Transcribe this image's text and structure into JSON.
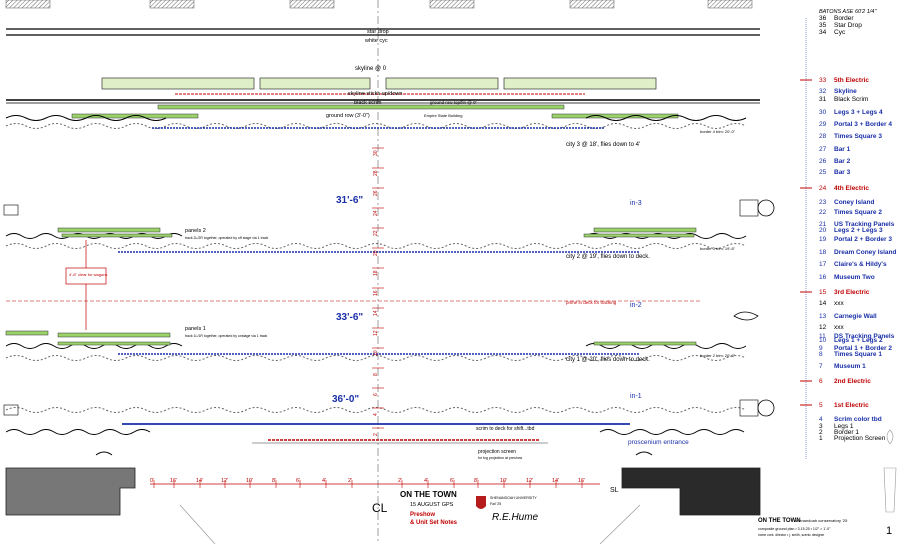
{
  "drawing": {
    "center_mark": "CL",
    "sl_mark": "SL",
    "title_block": {
      "show": "ON THE TOWN",
      "date": "15 AUGUST GPS",
      "note1": "Preshow",
      "note2": "& Unit Set Notes",
      "school": "SHENANDOAH UNIVERSITY",
      "term": "Fall '25",
      "signature": "R.E.Hume"
    },
    "corner_title": {
      "show": "ON THE TOWN",
      "sub1": "shenandoah conservatory '25",
      "sub2": "composite ground plan  •  3.15.25  •  1/2\" = 1'-0\"",
      "sub3": "home cont. director • j. smith, scenic designer",
      "sheet": "1"
    }
  },
  "labels": {
    "star_drop": "star drop",
    "white_cyc": "white cyc",
    "skyline": "skyline @ 0",
    "skyline_sticks": "skyline sticks up/down",
    "black_scrim": "black scrim",
    "ground_row": "ground row (3'-0\")",
    "ground_row_top": "ground row top/fin @ 0'",
    "empire_state": "Empire State Building",
    "city3": "city 3 @ 18', flies down to 4'",
    "city2": "city 2 @ 19', flies down to deck.",
    "city1": "city 1 @ 20', flies down to deck.",
    "border4_trim": "border 4 trim: 20'-0\"",
    "border3_trim": "border 3 trim: 19'-6\"",
    "border2_trim": "border 2 trim: 20'-6\"",
    "panels2": "panels 2",
    "panels2_note": "track 2L/2R together, operated by off stage via 1 track",
    "panels1": "panels 1",
    "panels1_note": "track 1L/1R together, operated by onstage via 1 track",
    "wagon_clear": "4'-6\" clear for wagons",
    "prime_deck": "prime in deck for tracking",
    "scrim_deck": "scrim to deck for shift...tbd",
    "proscenium": "proscenium entrance",
    "projection_screen": "projection screen",
    "projection_note": "for fog projection at preshow",
    "dim_31_6": "31'-6\"",
    "dim_33_6": "33'-6\"",
    "dim_36_0": "36'-0\"",
    "in3": "in-3",
    "in2": "in-2",
    "in1": "in-1",
    "depth_ticks": [
      "30",
      "28",
      "26",
      "24",
      "22",
      "20",
      "18",
      "16",
      "14",
      "12",
      "10",
      "8",
      "6",
      "4",
      "2"
    ],
    "width_ticks": [
      "0'",
      "16'",
      "14'",
      "12'",
      "10'",
      "8'",
      "6'",
      "4'",
      "2'",
      "2'",
      "4'",
      "6'",
      "8'",
      "10'",
      "12'",
      "14'",
      "16'"
    ]
  },
  "lineset_key": {
    "header": "BATONS ASE 60'2 1/4\"",
    "items": [
      {
        "num": "36",
        "name": "Border",
        "color": "black"
      },
      {
        "num": "35",
        "name": "Star Drop",
        "color": "black"
      },
      {
        "num": "34",
        "name": "Cyc",
        "color": "black"
      },
      {
        "num": "33",
        "name": "5th Electric",
        "color": "red"
      },
      {
        "num": "32",
        "name": "Skyline",
        "color": "blue"
      },
      {
        "num": "31",
        "name": "Black Scrim",
        "color": "black"
      },
      {
        "num": "30",
        "name": "Legs 3 + Legs 4",
        "color": "blue"
      },
      {
        "num": "29",
        "name": "Portal 3 + Border 4",
        "color": "blue"
      },
      {
        "num": "28",
        "name": "Times Square 3",
        "color": "blue"
      },
      {
        "num": "27",
        "name": "Bar 1",
        "color": "blue"
      },
      {
        "num": "26",
        "name": "Bar 2",
        "color": "blue"
      },
      {
        "num": "25",
        "name": "Bar 3",
        "color": "blue"
      },
      {
        "num": "24",
        "name": "4th Electric",
        "color": "red"
      },
      {
        "num": "23",
        "name": "Coney Island",
        "color": "blue"
      },
      {
        "num": "22",
        "name": "Times Square 2",
        "color": "blue"
      },
      {
        "num": "21",
        "name": "US Tracking Panels",
        "color": "blue"
      },
      {
        "num": "20",
        "name": "Legs 2 + Legs 3",
        "color": "blue"
      },
      {
        "num": "19",
        "name": "Portal 2 + Border 3",
        "color": "blue"
      },
      {
        "num": "18",
        "name": "Dream Coney Island",
        "color": "blue"
      },
      {
        "num": "17",
        "name": "Claire's & Hildy's",
        "color": "blue"
      },
      {
        "num": "16",
        "name": "Museum Two",
        "color": "blue"
      },
      {
        "num": "15",
        "name": "3rd Electric",
        "color": "red"
      },
      {
        "num": "14",
        "name": "xxx",
        "color": "black"
      },
      {
        "num": "13",
        "name": "Carnegie Wall",
        "color": "blue"
      },
      {
        "num": "12",
        "name": "xxx",
        "color": "black"
      },
      {
        "num": "11",
        "name": "DS Tracking Panels",
        "color": "blue"
      },
      {
        "num": "10",
        "name": "Legs 1 + Legs 2",
        "color": "blue"
      },
      {
        "num": "9",
        "name": "Portal 1 + Border 2",
        "color": "blue"
      },
      {
        "num": "8",
        "name": "Times Square 1",
        "color": "blue"
      },
      {
        "num": "7",
        "name": "Museum 1",
        "color": "blue"
      },
      {
        "num": "6",
        "name": "2nd Electric",
        "color": "red"
      },
      {
        "num": "5",
        "name": "1st Electric",
        "color": "red"
      },
      {
        "num": "4",
        "name": "Scrim color tbd",
        "color": "blue"
      },
      {
        "num": "3",
        "name": "Legs 1",
        "color": "black"
      },
      {
        "num": "2",
        "name": "Border 1",
        "color": "black"
      },
      {
        "num": "1",
        "name": "Projection Screen",
        "color": "black"
      }
    ]
  },
  "colors": {
    "electric_red": "#c00000",
    "scenery_blue": "#1a2fa8",
    "wagon_green": "#9bd36a",
    "cl_line": "#c00000"
  }
}
